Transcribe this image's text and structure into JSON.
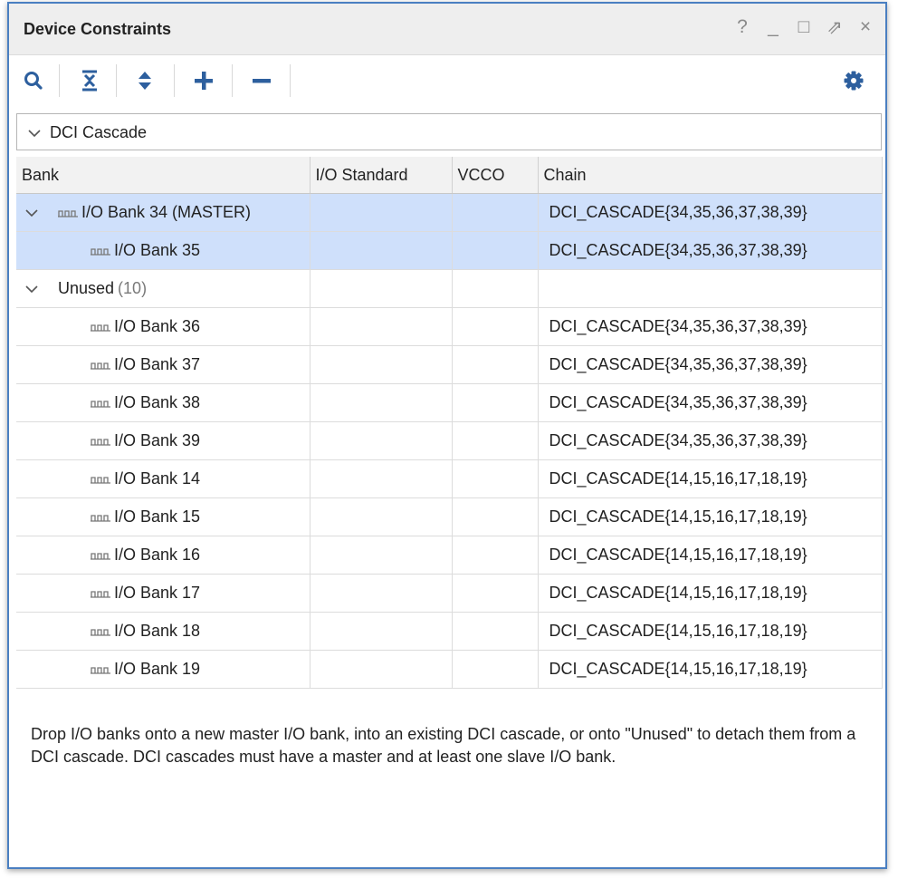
{
  "window": {
    "title": "Device Constraints",
    "buttons": [
      "?",
      "_",
      "□",
      "⇗",
      "×"
    ]
  },
  "toolbar": {
    "icons": [
      "search-icon",
      "collapse-all-icon",
      "expand-all-icon",
      "add-icon",
      "remove-icon",
      "gear-icon"
    ]
  },
  "group": {
    "label": "DCI Cascade"
  },
  "table": {
    "columns": [
      "Bank",
      "I/O Standard",
      "VCCO",
      "Chain"
    ],
    "master_row": {
      "bank": "I/O Bank 34 (MASTER)",
      "io_standard": "",
      "vcco": "",
      "chain": "DCI_CASCADE{34,35,36,37,38,39}"
    },
    "slave_rows": [
      {
        "bank": "I/O Bank 35",
        "io_standard": "",
        "vcco": "",
        "chain": "DCI_CASCADE{34,35,36,37,38,39}"
      }
    ],
    "unused_label": "Unused",
    "unused_count": "(10)",
    "unused_rows": [
      {
        "bank": "I/O Bank 36",
        "io_standard": "",
        "vcco": "",
        "chain": "DCI_CASCADE{34,35,36,37,38,39}"
      },
      {
        "bank": "I/O Bank 37",
        "io_standard": "",
        "vcco": "",
        "chain": "DCI_CASCADE{34,35,36,37,38,39}"
      },
      {
        "bank": "I/O Bank 38",
        "io_standard": "",
        "vcco": "",
        "chain": "DCI_CASCADE{34,35,36,37,38,39}"
      },
      {
        "bank": "I/O Bank 39",
        "io_standard": "",
        "vcco": "",
        "chain": "DCI_CASCADE{34,35,36,37,38,39}"
      },
      {
        "bank": "I/O Bank 14",
        "io_standard": "",
        "vcco": "",
        "chain": "DCI_CASCADE{14,15,16,17,18,19}"
      },
      {
        "bank": "I/O Bank 15",
        "io_standard": "",
        "vcco": "",
        "chain": "DCI_CASCADE{14,15,16,17,18,19}"
      },
      {
        "bank": "I/O Bank 16",
        "io_standard": "",
        "vcco": "",
        "chain": "DCI_CASCADE{14,15,16,17,18,19}"
      },
      {
        "bank": "I/O Bank 17",
        "io_standard": "",
        "vcco": "",
        "chain": "DCI_CASCADE{14,15,16,17,18,19}"
      },
      {
        "bank": "I/O Bank 18",
        "io_standard": "",
        "vcco": "",
        "chain": "DCI_CASCADE{14,15,16,17,18,19}"
      },
      {
        "bank": "I/O Bank 19",
        "io_standard": "",
        "vcco": "",
        "chain": "DCI_CASCADE{14,15,16,17,18,19}"
      }
    ]
  },
  "description": "Drop I/O banks onto a new master I/O bank, into an existing DCI cascade, or onto \"Unused\" to detach them from a DCI cascade. DCI cascades must have a master and at least one slave I/O bank.",
  "colors": {
    "selected_row": "#cfe0fb",
    "accent": "#4a7fc1",
    "icon_blue": "#2d5f9e"
  }
}
